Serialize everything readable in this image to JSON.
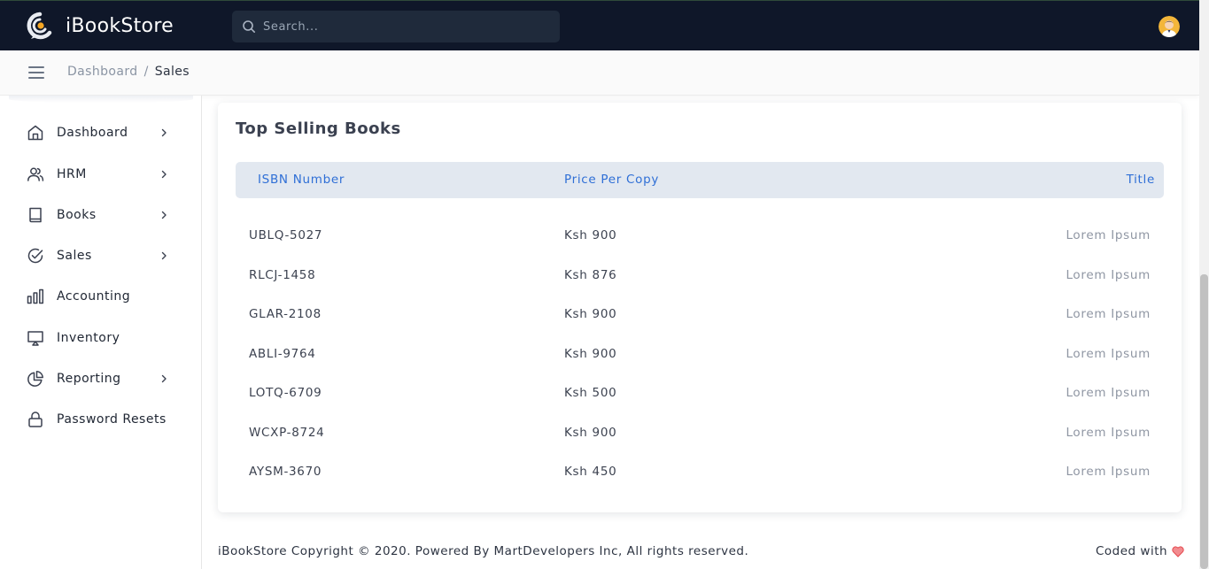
{
  "app": {
    "name": "iBookStore"
  },
  "search": {
    "placeholder": "Search..."
  },
  "breadcrumb": {
    "parent": "Dashboard",
    "separator": "/",
    "current": "Sales"
  },
  "sidebar": {
    "items": [
      {
        "label": "Dashboard",
        "icon": "home-icon",
        "has_chevron": true
      },
      {
        "label": "HRM",
        "icon": "users-icon",
        "has_chevron": true
      },
      {
        "label": "Books",
        "icon": "book-icon",
        "has_chevron": true
      },
      {
        "label": "Sales",
        "icon": "check-circle-icon",
        "has_chevron": true
      },
      {
        "label": "Accounting",
        "icon": "bar-chart-icon",
        "has_chevron": false
      },
      {
        "label": "Inventory",
        "icon": "monitor-icon",
        "has_chevron": false
      },
      {
        "label": "Reporting",
        "icon": "pie-chart-icon",
        "has_chevron": true
      },
      {
        "label": "Password Resets",
        "icon": "lock-icon",
        "has_chevron": false
      }
    ]
  },
  "card": {
    "title": "Top Selling Books",
    "columns": {
      "isbn": "ISBN Number",
      "price": "Price Per Copy",
      "title": "Title"
    },
    "rows": [
      {
        "isbn": "UBLQ-5027",
        "price": "Ksh 900",
        "title": "Lorem Ipsum"
      },
      {
        "isbn": "RLCJ-1458",
        "price": "Ksh 876",
        "title": "Lorem Ipsum"
      },
      {
        "isbn": "GLAR-2108",
        "price": "Ksh 900",
        "title": "Lorem Ipsum"
      },
      {
        "isbn": "ABLI-9764",
        "price": "Ksh 900",
        "title": "Lorem Ipsum"
      },
      {
        "isbn": "LOTQ-6709",
        "price": "Ksh 500",
        "title": "Lorem Ipsum"
      },
      {
        "isbn": "WCXP-8724",
        "price": "Ksh 900",
        "title": "Lorem Ipsum"
      },
      {
        "isbn": "AYSM-3670",
        "price": "Ksh 450",
        "title": "Lorem Ipsum"
      }
    ]
  },
  "footer": {
    "copyright": "iBookStore Copyright © 2020. Powered By MartDevelopers Inc, All rights reserved.",
    "coded_with": "Coded with",
    "heart_icon": "heart-icon"
  },
  "colors": {
    "topbar": "#0f1729",
    "accent_blue": "#2f6fd6",
    "table_header_bg": "#e2e8f0",
    "logo_orange": "#f5a623",
    "heart": "#e5484d"
  }
}
